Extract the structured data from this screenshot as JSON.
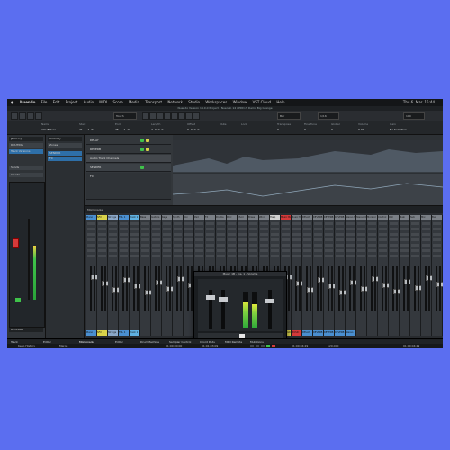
{
  "menubar": {
    "app_name": "Nuendo",
    "items": [
      "File",
      "Edit",
      "Project",
      "Audio",
      "MIDI",
      "Score",
      "Media",
      "Transport",
      "Network",
      "Studio",
      "Workspaces",
      "Window",
      "VST Cloud",
      "Help"
    ],
    "clock": "Thu 6. Mar. 15:44"
  },
  "title": "Nuendo Version 14.0.0 Project - Nuendo 14 XPDD-H Demo Big Grange",
  "toolbar": {
    "touch_mode": "Touch",
    "grid": "Bar",
    "quantize": "1/16",
    "zoom": "100"
  },
  "infoline": {
    "labels": [
      "Name",
      "Start",
      "End",
      "Length",
      "Offset",
      "Mute",
      "Lock",
      "Transpose",
      "Fine-Tune",
      "Global",
      "Volume",
      "Gain"
    ],
    "values": [
      "Alle Bläser",
      "21. 1. 1. 93",
      "25. 1. 1. 10",
      "4. 0. 0. 0",
      "0. 0. 0. 0",
      "",
      "",
      "0",
      "0",
      "0",
      "0.00",
      "No Selection"
    ]
  },
  "inspector": {
    "tab": "[Bläser]",
    "sections": [
      "ROUTING",
      "Track Versions",
      "Sends",
      "Inserts"
    ],
    "channel_label": "REVERB",
    "bottom_label": "REVERB1"
  },
  "visibility": {
    "tab": "Visibility",
    "zones": "Zones"
  },
  "tracks": [
    {
      "name": "DELAY",
      "color": "#5a5f66"
    },
    {
      "name": "REVERB",
      "color": "#5a5f66"
    },
    {
      "name": "Audio Track Channels",
      "color": "#44484d"
    },
    {
      "name": "SENDER",
      "color": "#5a5f66"
    },
    {
      "name": "FX",
      "color": "#4a4e53"
    }
  ],
  "mixer": {
    "header": "MixConsole",
    "strips": [
      {
        "name": "Piano 1",
        "color": "#4a8fd0"
      },
      {
        "name": "SFX 1",
        "color": "#d9d24a"
      },
      {
        "name": "Strings",
        "color": "#8aa7c8"
      },
      {
        "name": "FOL 1",
        "color": "#4a8fd0"
      },
      {
        "name": "Track 1",
        "color": "#5fb0e0"
      },
      {
        "name": "Bass",
        "color": "#7a7f86"
      },
      {
        "name": "Guitars",
        "color": "#7a7f86"
      },
      {
        "name": "Keys",
        "color": "#7a7f86"
      },
      {
        "name": "Synth",
        "color": "#7a7f86"
      },
      {
        "name": "Vox",
        "color": "#7a7f86"
      },
      {
        "name": "Pad",
        "color": "#7a7f86"
      },
      {
        "name": "FX",
        "color": "#7a7f86"
      },
      {
        "name": "Drums",
        "color": "#7a7f86"
      },
      {
        "name": "Perc",
        "color": "#7a7f86"
      },
      {
        "name": "Choir",
        "color": "#7a7f86"
      },
      {
        "name": "Brass",
        "color": "#7a7f86"
      },
      {
        "name": "Wind",
        "color": "#7a7f86"
      },
      {
        "name": "Harp",
        "color": "#d0d0d0"
      },
      {
        "name": "Music Bx",
        "color": "#d43a3a"
      },
      {
        "name": "Music Mgl",
        "color": "#7a7f86"
      },
      {
        "name": "DELAY",
        "color": "#7a7f86"
      },
      {
        "name": "REVERB",
        "color": "#7a7f86"
      },
      {
        "name": "REVERB",
        "color": "#7a7f86"
      },
      {
        "name": "REVERB",
        "color": "#7a7f86"
      },
      {
        "name": "Stereo Mst",
        "color": "#7a7f86"
      },
      {
        "name": "Stereo Out",
        "color": "#7a7f86"
      },
      {
        "name": "Monitor",
        "color": "#7a7f86"
      },
      {
        "name": "Control",
        "color": "#7a7f86"
      },
      {
        "name": "Out",
        "color": "#7a7f86"
      },
      {
        "name": "Main",
        "color": "#7a7f86"
      },
      {
        "name": "Sub",
        "color": "#7a7f86"
      },
      {
        "name": "Mix",
        "color": "#7a7f86"
      },
      {
        "name": "Bus",
        "color": "#7a7f86"
      }
    ],
    "footers": [
      {
        "name": "Piano 1",
        "color": "#4a8fd0"
      },
      {
        "name": "SFX 1",
        "color": "#d9d24a"
      },
      {
        "name": "Strings",
        "color": "#8aa7c8"
      },
      {
        "name": "FOL 1",
        "color": "#4a8fd0"
      },
      {
        "name": "Track 1",
        "color": "#5fb0e0"
      },
      {
        "name": "",
        "color": "#34383d"
      },
      {
        "name": "",
        "color": "#34383d"
      },
      {
        "name": "",
        "color": "#34383d"
      },
      {
        "name": "",
        "color": "#34383d"
      },
      {
        "name": "",
        "color": "#34383d"
      },
      {
        "name": "",
        "color": "#34383d"
      },
      {
        "name": "",
        "color": "#34383d"
      },
      {
        "name": "",
        "color": "#34383d"
      },
      {
        "name": "",
        "color": "#34383d"
      },
      {
        "name": "",
        "color": "#34383d"
      },
      {
        "name": "",
        "color": "#34383d"
      },
      {
        "name": "",
        "color": "#34383d"
      },
      {
        "name": "SENDER",
        "color": "#d43a3a"
      },
      {
        "name": "BACKGR",
        "color": "#d9d24a"
      },
      {
        "name": "MUSIC",
        "color": "#d43a3a"
      },
      {
        "name": "DELAY",
        "color": "#4a8fd0"
      },
      {
        "name": "REVERB",
        "color": "#4a8fd0"
      },
      {
        "name": "REVERB",
        "color": "#4a8fd0"
      },
      {
        "name": "REVERB",
        "color": "#4a8fd0"
      },
      {
        "name": "Stereo",
        "color": "#4a8fd0"
      }
    ]
  },
  "plugin": {
    "title": "Music 1B - Ins. 1 - Volume",
    "brand": "steinberg",
    "name": "volume",
    "level_left": 0.72,
    "level_right": 0.66
  },
  "statusbar": {
    "items": [
      "Track",
      "Editor",
      "MixConsole",
      "Editor",
      "DrumMachine",
      "Sampler Control",
      "Chord Pads",
      "MIDI Remote",
      "Mutations"
    ]
  },
  "transport": {
    "history": "Keep History",
    "mode": "Merge",
    "position_1": "01:00:00:00",
    "position_2": "01:01:03:09",
    "position_3": "01:00:04:29",
    "tempo": "120.000",
    "position_4": "01:00:04:29"
  },
  "colors": {
    "background": "#5b6ef0",
    "window": "#2b2f33",
    "accent_green": "#3fc24a",
    "accent_red": "#d43a3a",
    "accent_yellow": "#d9d24a",
    "accent_blue": "#4a8fd0"
  }
}
